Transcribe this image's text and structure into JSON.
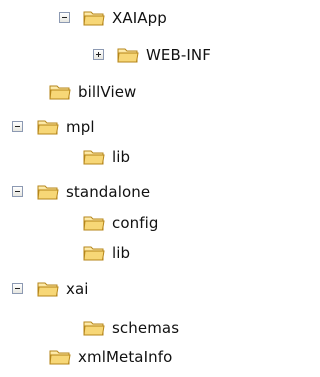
{
  "tree": {
    "nodes": [
      {
        "label": "XAIApp",
        "state": "expanded",
        "icon": "folder-icon"
      },
      {
        "label": "WEB-INF",
        "state": "collapsed",
        "icon": "folder-icon"
      },
      {
        "label": "billView",
        "state": "leaf",
        "icon": "folder-icon"
      },
      {
        "label": "mpl",
        "state": "expanded",
        "icon": "folder-icon"
      },
      {
        "label": "lib",
        "state": "leaf",
        "icon": "folder-icon"
      },
      {
        "label": "standalone",
        "state": "expanded",
        "icon": "folder-icon"
      },
      {
        "label": "config",
        "state": "leaf",
        "icon": "folder-icon"
      },
      {
        "label": "lib",
        "state": "leaf",
        "icon": "folder-icon"
      },
      {
        "label": "xai",
        "state": "expanded",
        "icon": "folder-icon"
      },
      {
        "label": "schemas",
        "state": "leaf",
        "icon": "folder-icon"
      },
      {
        "label": "xmlMetaInfo",
        "state": "leaf",
        "icon": "folder-icon"
      }
    ]
  },
  "colors": {
    "folder_fill": "#f3d06b",
    "folder_light": "#ffe9a6",
    "folder_outline": "#b68619",
    "toggle_border": "#8c99b2"
  }
}
